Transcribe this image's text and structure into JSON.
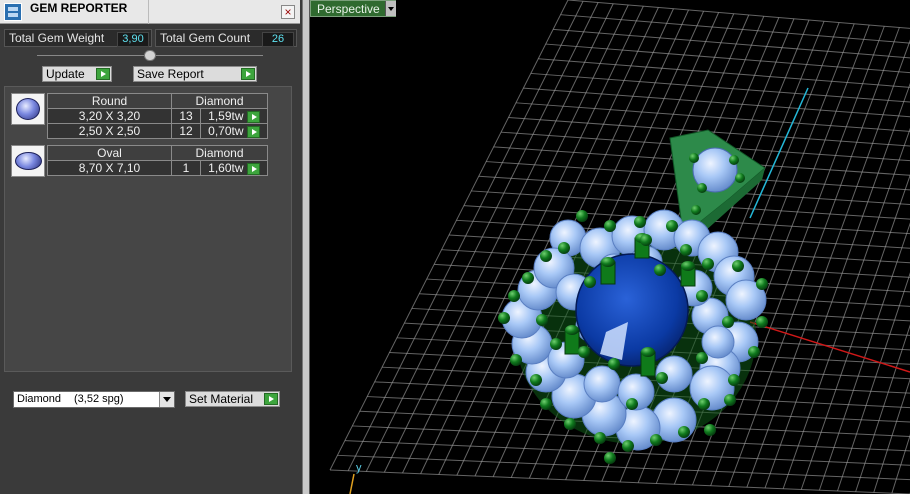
{
  "titlebar": {
    "title": "GEM REPORTER",
    "close_glyph": "×"
  },
  "stats": {
    "total_weight_label": "Total Gem Weight",
    "total_weight_value": "3,90",
    "total_count_label": "Total Gem Count",
    "total_count_value": "26"
  },
  "buttons": {
    "update": "Update",
    "save_report": "Save Report",
    "set_material": "Set Material"
  },
  "gem_groups": [
    {
      "shape": "Round",
      "material": "Diamond",
      "rows": [
        {
          "size": "3,20 X 3,20",
          "count": "13",
          "weight": "1,59tw"
        },
        {
          "size": "2,50 X 2,50",
          "count": "12",
          "weight": "0,70tw"
        }
      ]
    },
    {
      "shape": "Oval",
      "material": "Diamond",
      "rows": [
        {
          "size": "8,70 X 7,10",
          "count": "1",
          "weight": "1,60tw"
        }
      ]
    }
  ],
  "material_select": {
    "name": "Diamond",
    "spg": "(3,52 spg)"
  },
  "viewport": {
    "view_name": "Perspective",
    "axis_y": "y"
  },
  "colors": {
    "accent_green": "#3da53d",
    "value_cyan": "#5fe2f0",
    "gem_light": "#9fc3f5",
    "gem_center": "#0d3aa8",
    "prong_green": "#0f7a1a",
    "bail_green": "#2d8a4a"
  },
  "icons": {
    "app": "gem-reporter-app-icon",
    "close": "close-icon",
    "round_gem": "round-gem-icon",
    "oval_gem": "oval-gem-icon",
    "go_arrow": "green-arrow-icon",
    "dropdown": "chevron-down-icon"
  }
}
